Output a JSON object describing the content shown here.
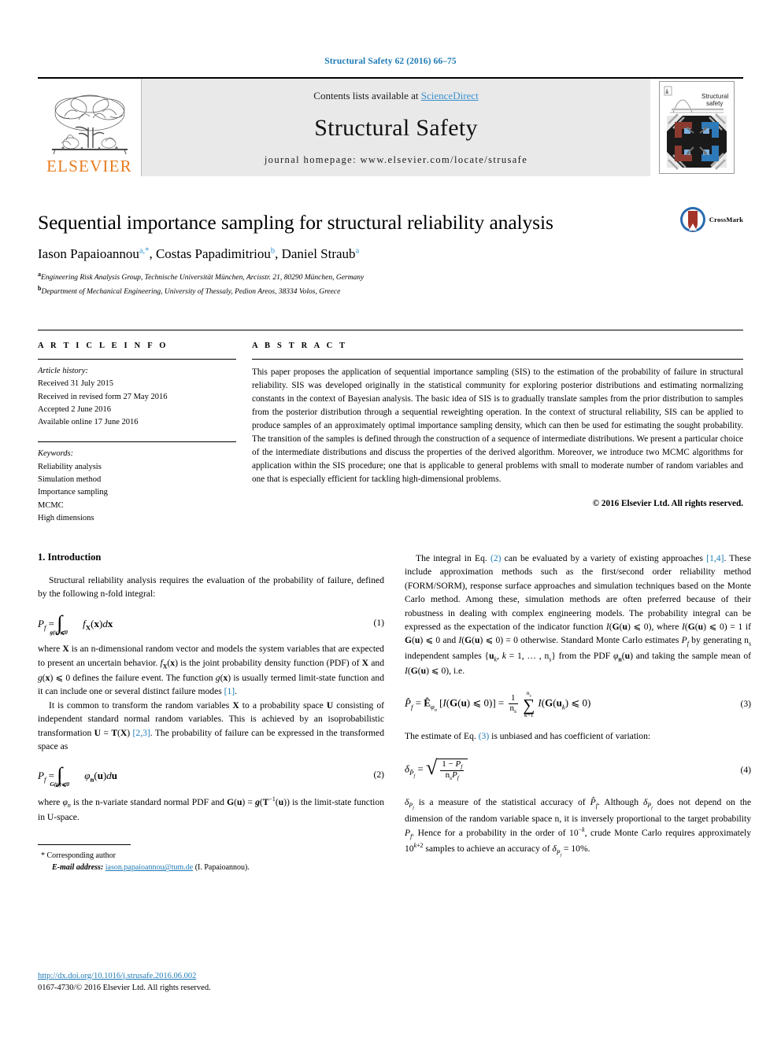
{
  "running_head": "Structural Safety 62 (2016) 66–75",
  "masthead": {
    "publisher_logo_text": "ELSEVIER",
    "contents_prefix": "Contents lists available at ",
    "contents_link": "ScienceDirect",
    "journal_name": "Structural Safety",
    "homepage": "journal homepage: www.elsevier.com/locate/strusafe",
    "cover_title_line1": "Structural",
    "cover_title_line2": "safety"
  },
  "article": {
    "title": "Sequential importance sampling for structural reliability analysis",
    "crossmark_label": "CrossMark",
    "authors": [
      {
        "name": "Iason Papaioannou",
        "marks": "a,*"
      },
      {
        "name": "Costas Papadimitriou",
        "marks": "b"
      },
      {
        "name": "Daniel Straub",
        "marks": "a"
      }
    ],
    "affiliations": [
      {
        "mark": "a",
        "text": "Engineering Risk Analysis Group, Technische Universität München, Arcisstr. 21, 80290 München, Germany"
      },
      {
        "mark": "b",
        "text": "Department of Mechanical Engineering, University of Thessaly, Pedion Areos, 38334 Volos, Greece"
      }
    ]
  },
  "info": {
    "heading": "A R T I C L E    I N F O",
    "history_label": "Article history:",
    "history": [
      "Received 31 July 2015",
      "Received in revised form 27 May 2016",
      "Accepted 2 June 2016",
      "Available online 17 June 2016"
    ],
    "keywords_label": "Keywords:",
    "keywords": [
      "Reliability analysis",
      "Simulation method",
      "Importance sampling",
      "MCMC",
      "High dimensions"
    ]
  },
  "abstract": {
    "heading": "A B S T R A C T",
    "text": "This paper proposes the application of sequential importance sampling (SIS) to the estimation of the probability of failure in structural reliability. SIS was developed originally in the statistical community for exploring posterior distributions and estimating normalizing constants in the context of Bayesian analysis. The basic idea of SIS is to gradually translate samples from the prior distribution to samples from the posterior distribution through a sequential reweighting operation. In the context of structural reliability, SIS can be applied to produce samples of an approximately optimal importance sampling density, which can then be used for estimating the sought probability. The transition of the samples is defined through the construction of a sequence of intermediate distributions. We present a particular choice of the intermediate distributions and discuss the properties of the derived algorithm. Moreover, we introduce two MCMC algorithms for application within the SIS procedure; one that is applicable to general problems with small to moderate number of random variables and one that is especially efficient for tackling high-dimensional problems.",
    "copyright": "© 2016 Elsevier Ltd. All rights reserved."
  },
  "body": {
    "section_title": "1. Introduction",
    "left": {
      "p1": "Structural reliability analysis requires the evaluation of the probability of failure, defined by the following n-fold integral:",
      "eq1_num": "(1)",
      "p2_a": "where ",
      "p2_b": " is an n-dimensional random vector and models the system variables that are expected to present an uncertain behavior. ",
      "p2_c": " is the joint probability density function (PDF) of ",
      "p2_d": " and ",
      "p2_e": " defines the failure event. The function ",
      "p2_f": " is usually termed limit-state function and it can include one or several distinct failure modes ",
      "p2_ref": "[1]",
      "p3_a": "It is common to transform the random variables ",
      "p3_b": " to a probability space ",
      "p3_c": " consisting of independent standard normal random variables. This is achieved by an isoprobabilistic transformation ",
      "p3_ref": "[2,3]",
      "p3_d": ". The probability of failure can be expressed in the transformed space as",
      "eq2_num": "(2)",
      "p4_a": "where ",
      "p4_b": " is the n-variate standard normal PDF and ",
      "p4_c": " is the limit-state function in U-space."
    },
    "right": {
      "p1_a": "The integral in Eq. ",
      "p1_ref1": "(2)",
      "p1_b": " can be evaluated by a variety of existing approaches ",
      "p1_ref2": "[1,4]",
      "p1_c": ". These include approximation methods such as the first/second order reliability method (FORM/SORM), response surface approaches and simulation techniques based on the Monte Carlo method. Among these, simulation methods are often preferred because of their robustness in dealing with complex engineering models. The probability integral can be expressed as the expectation of the indicator function ",
      "p1_d": ", where ",
      "p1_e": " if ",
      "p1_f": " and ",
      "p1_g": " otherwise. Standard Monte Carlo estimates ",
      "p1_h": " by generating ",
      "p1_i": " independent samples ",
      "p1_j": " from the PDF ",
      "p1_k": " and taking the sample mean of ",
      "p1_l": ", i.e.",
      "eq3_num": "(3)",
      "p2_a": "The estimate of Eq. ",
      "p2_ref": "(3)",
      "p2_b": " is unbiased and has coefficient of variation:",
      "eq4_num": "(4)",
      "p3_a": " is a measure of the statistical accuracy of ",
      "p3_b": ". Although ",
      "p3_c": " does not depend on the dimension of the random variable space n, it is inversely proportional to the target probability ",
      "p3_d": ". Hence for a probability in the order of ",
      "p3_e": ", crude Monte Carlo requires approximately ",
      "p3_f": " samples to achieve an accuracy of ",
      "p3_g": " = 10%."
    }
  },
  "footnote": {
    "corresponding": "* Corresponding author",
    "email_label": "E-mail address:",
    "email": "iason.papaioannou@tum.de",
    "email_owner": "(I. Papaioannou)."
  },
  "footer": {
    "doi": "http://dx.doi.org/10.1016/j.strusafe.2016.06.002",
    "issn_line": "0167-4730/© 2016 Elsevier Ltd. All rights reserved."
  },
  "colors": {
    "link_blue": "#1f7bb6",
    "sciencedirect_blue": "#3c92cf",
    "elsevier_orange": "#e87b1e",
    "masthead_gray": "#e9e9e9"
  }
}
